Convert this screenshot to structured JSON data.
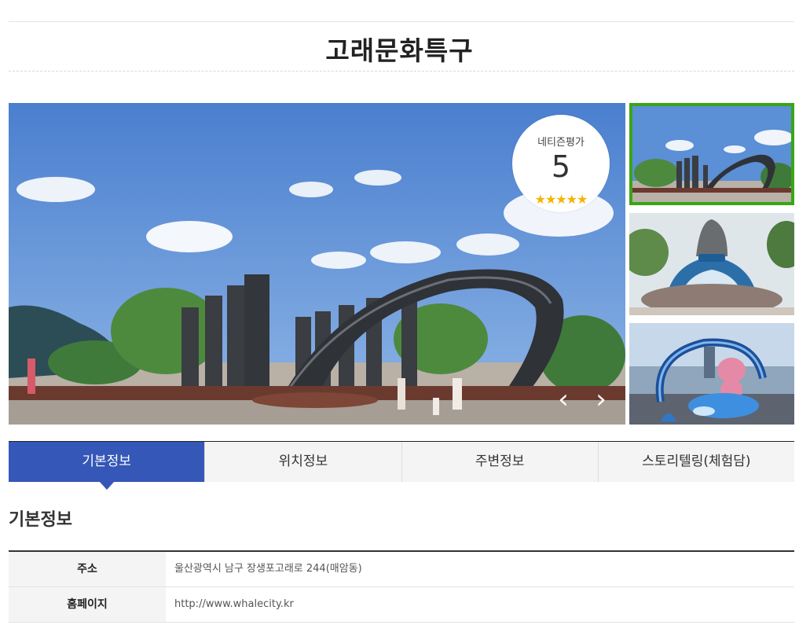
{
  "page": {
    "title": "고래문화특구"
  },
  "gallery": {
    "rating": {
      "label": "네티즌평가",
      "score": "5",
      "stars": "★★★★★",
      "star_count": 5
    },
    "prev_label": "‹",
    "next_label": "›",
    "thumbnails": [
      {
        "selected": true
      },
      {
        "selected": false
      },
      {
        "selected": false
      }
    ],
    "colors": {
      "selected_border": "#3aa517",
      "sky": "#5b8fd6",
      "foliage": "#4a7a34"
    }
  },
  "tabs": [
    {
      "label": "기본정보",
      "active": true
    },
    {
      "label": "위치정보",
      "active": false
    },
    {
      "label": "주변정보",
      "active": false
    },
    {
      "label": "스토리텔링(체험담)",
      "active": false
    }
  ],
  "section": {
    "title": "기본정보"
  },
  "info": [
    {
      "key": "주소",
      "value": "울산광역시 남구 장생포고래로 244(매암동)"
    },
    {
      "key": "홈페이지",
      "value": "http://www.whalecity.kr"
    }
  ],
  "theme": {
    "active_tab": "#3557b7"
  }
}
